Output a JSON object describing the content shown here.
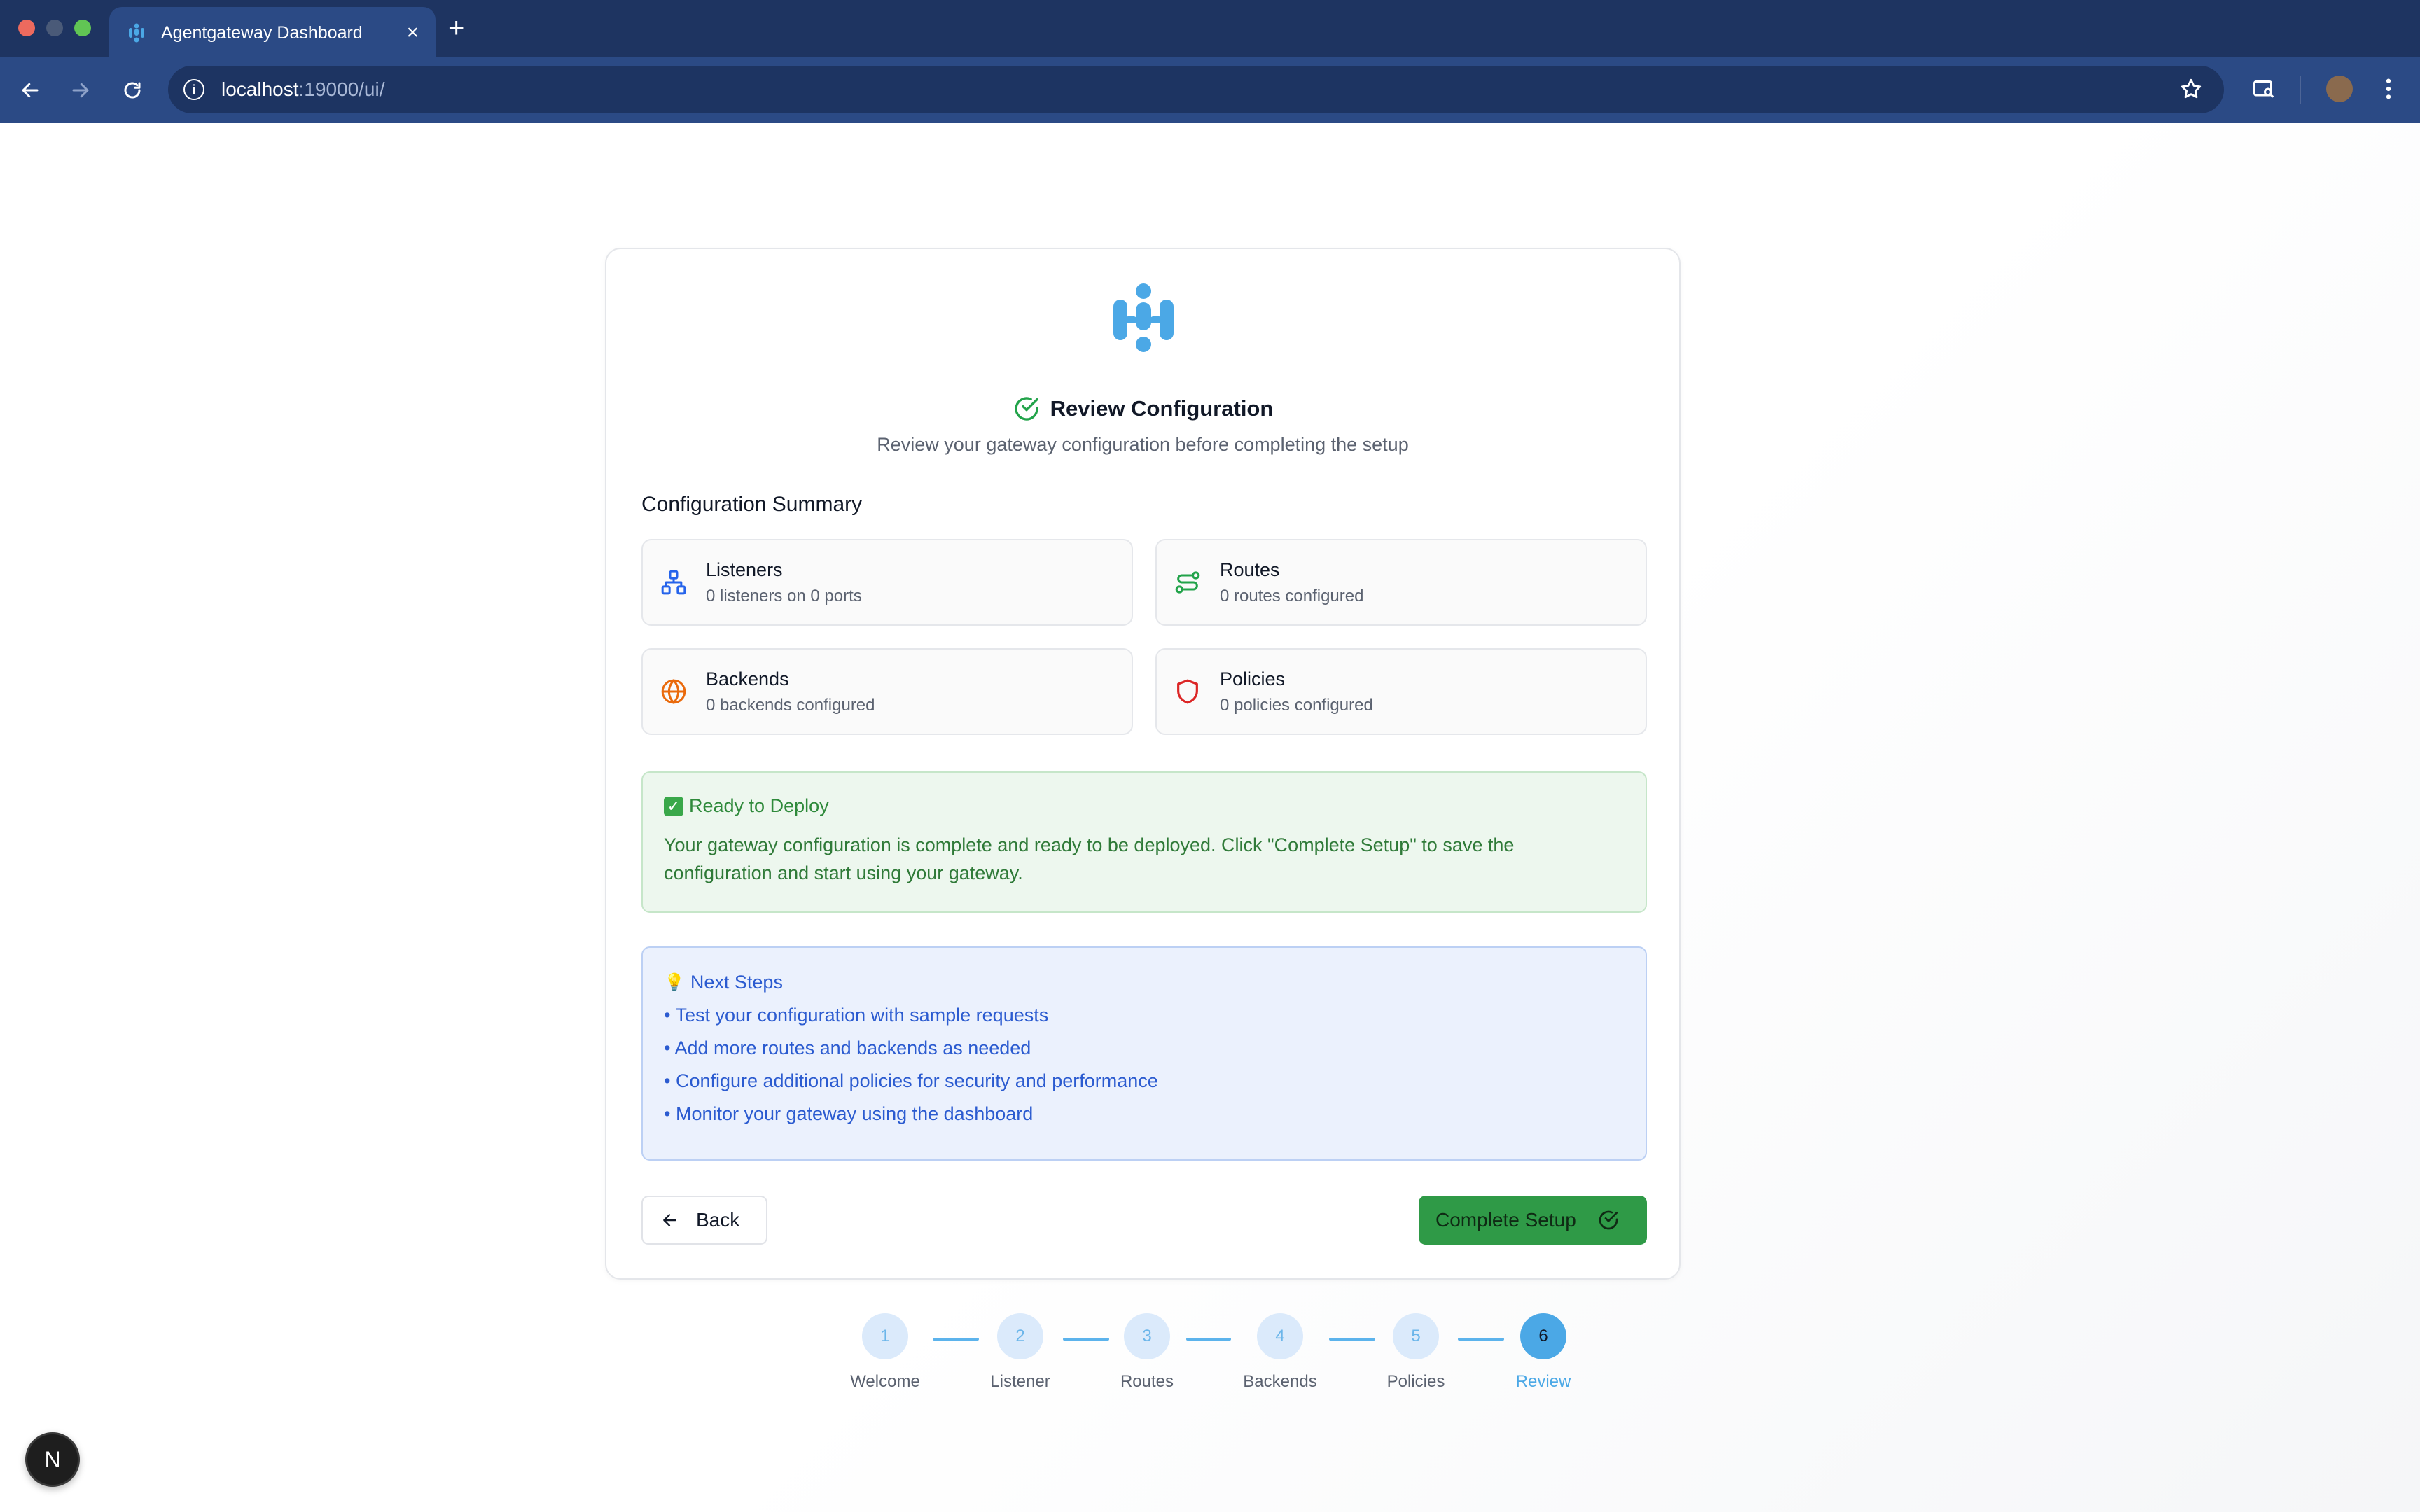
{
  "browser": {
    "tab_title": "Agentgateway Dashboard",
    "tab_close": "×",
    "new_tab": "+",
    "url_host": "localhost",
    "url_rest": ":19000/ui/"
  },
  "header": {
    "title": "Review Configuration",
    "subtitle": "Review your gateway configuration before completing the setup"
  },
  "summary": {
    "heading": "Configuration Summary",
    "items": [
      {
        "label": "Listeners",
        "detail": "0 listeners on 0 ports",
        "icon": "network-icon",
        "color": "#2563eb"
      },
      {
        "label": "Routes",
        "detail": "0 routes configured",
        "icon": "route-icon",
        "color": "#22a34a"
      },
      {
        "label": "Backends",
        "detail": "0 backends configured",
        "icon": "globe-icon",
        "color": "#ea6a0c"
      },
      {
        "label": "Policies",
        "detail": "0 policies configured",
        "icon": "shield-icon",
        "color": "#dc2626"
      }
    ]
  },
  "ready": {
    "title": "Ready to Deploy",
    "body": "Your gateway configuration is complete and ready to be deployed. Click \"Complete Setup\" to save the configuration and start using your gateway."
  },
  "next_steps": {
    "title": "Next Steps",
    "items": [
      "• Test your configuration with sample requests",
      "• Add more routes and backends as needed",
      "• Configure additional policies for security and performance",
      "• Monitor your gateway using the dashboard"
    ]
  },
  "actions": {
    "back_label": "Back",
    "complete_label": "Complete Setup"
  },
  "stepper": {
    "steps": [
      {
        "number": "1",
        "label": "Welcome",
        "active": false
      },
      {
        "number": "2",
        "label": "Listener",
        "active": false
      },
      {
        "number": "3",
        "label": "Routes",
        "active": false
      },
      {
        "number": "4",
        "label": "Backends",
        "active": false
      },
      {
        "number": "5",
        "label": "Policies",
        "active": false
      },
      {
        "number": "6",
        "label": "Review",
        "active": true
      }
    ]
  },
  "dev_badge": "N",
  "colors": {
    "accent_blue": "#4ba8e6",
    "success_green": "#2f9a47",
    "chrome_dark": "#1e3461"
  }
}
